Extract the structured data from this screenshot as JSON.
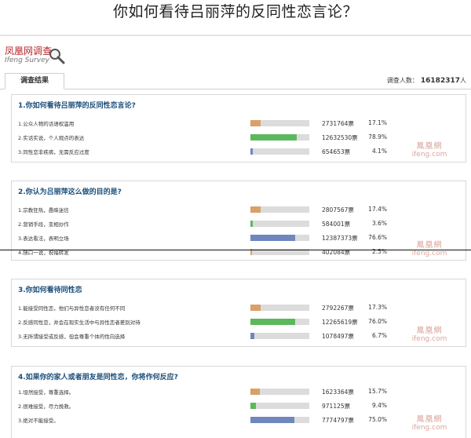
{
  "title": "你如何看待吕丽萍的反同性恋言论？",
  "logo": {
    "cn": "凤凰网调查",
    "en": "Ifeng Survey"
  },
  "tab": "调查结果",
  "participants": {
    "label": "调查人数：",
    "value": "16182317",
    "suffix": "人"
  },
  "watermark": {
    "cn": "鳳凰網",
    "en": "ifeng.com"
  },
  "colors": {
    "orange": "#d9a06a",
    "green": "#5cb85c",
    "blue": "#6f87bd",
    "accent_title": "#1c4f7a"
  },
  "questions": [
    {
      "title": "1.你如何看待吕丽萍的反同性恋言论?",
      "options": [
        {
          "label": "1.公众人物的话语权滥用",
          "votes": "2731764票",
          "pct": "17.1%",
          "fraction": 0.171,
          "color": "orange"
        },
        {
          "label": "2.实话实说，个人观点的表达",
          "votes": "12632530票",
          "pct": "78.9%",
          "fraction": 0.789,
          "color": "green"
        },
        {
          "label": "3.同性恋非疾病，无需反应过度",
          "votes": "654653票",
          "pct": "4.1%",
          "fraction": 0.041,
          "color": "blue"
        }
      ]
    },
    {
      "title": "2.你认为吕丽萍这么做的目的是?",
      "options": [
        {
          "label": "1.宗教狂热，愚昧迷信",
          "votes": "2807567票",
          "pct": "17.4%",
          "fraction": 0.174,
          "color": "orange"
        },
        {
          "label": "2.营销手段，变相炒作",
          "votes": "584001票",
          "pct": "3.6%",
          "fraction": 0.036,
          "color": "green"
        },
        {
          "label": "3.表达看法，表明立场",
          "votes": "12387373票",
          "pct": "76.6%",
          "fraction": 0.766,
          "color": "blue"
        },
        {
          "label": "4.随口一说，祝福转发",
          "votes": "402084票",
          "pct": "2.5%",
          "fraction": 0.025,
          "color": "orange"
        }
      ]
    },
    {
      "title": "3.你如何看待同性恋",
      "options": [
        {
          "label": "1.能接受同性恋，他们与异性恋者没有任何不同",
          "votes": "2792267票",
          "pct": "17.3%",
          "fraction": 0.173,
          "color": "orange"
        },
        {
          "label": "2.反感同性恋，并会在现实生活中与异性恋者差别对待",
          "votes": "12265619票",
          "pct": "76.0%",
          "fraction": 0.76,
          "color": "green"
        },
        {
          "label": "3.无所谓接受或反感，但会尊重个体的性向选择",
          "votes": "1078497票",
          "pct": "6.7%",
          "fraction": 0.067,
          "color": "blue"
        }
      ]
    },
    {
      "title": "4.如果你的家人或者朋友是同性恋，你将作何反应?",
      "options": [
        {
          "label": "1.坦然接受，尊重选择。",
          "votes": "1623364票",
          "pct": "15.7%",
          "fraction": 0.157,
          "color": "orange"
        },
        {
          "label": "2.很难接受，尽力挽救。",
          "votes": "971125票",
          "pct": "9.4%",
          "fraction": 0.094,
          "color": "green"
        },
        {
          "label": "3.绝对不能接受。",
          "votes": "7774797票",
          "pct": "75.0%",
          "fraction": 0.75,
          "color": "blue"
        }
      ]
    }
  ]
}
